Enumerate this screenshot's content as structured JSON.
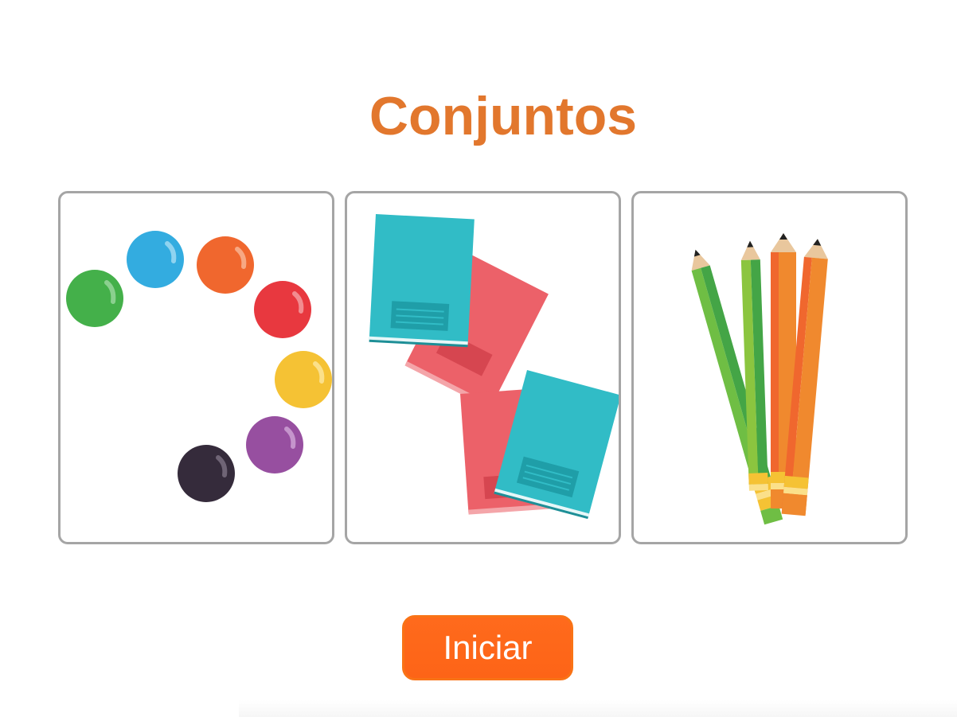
{
  "title": "Conjuntos",
  "start_button_label": "Iniciar",
  "colors": {
    "title": "#e2772d",
    "button": "#fd6417",
    "card_border": "#a5a5a5"
  },
  "cards": [
    {
      "icon": "colored-balls",
      "ball_colors": [
        "#44b04a",
        "#33ace0",
        "#f0672e",
        "#e8383f",
        "#f5c234",
        "#974fa0",
        "#352b3b"
      ]
    },
    {
      "icon": "books",
      "book_colors": [
        "#31bcc6",
        "#ec6169"
      ]
    },
    {
      "icon": "colored-pencils",
      "pencil_colors": [
        "#6fbe44",
        "#f0892e"
      ]
    }
  ]
}
